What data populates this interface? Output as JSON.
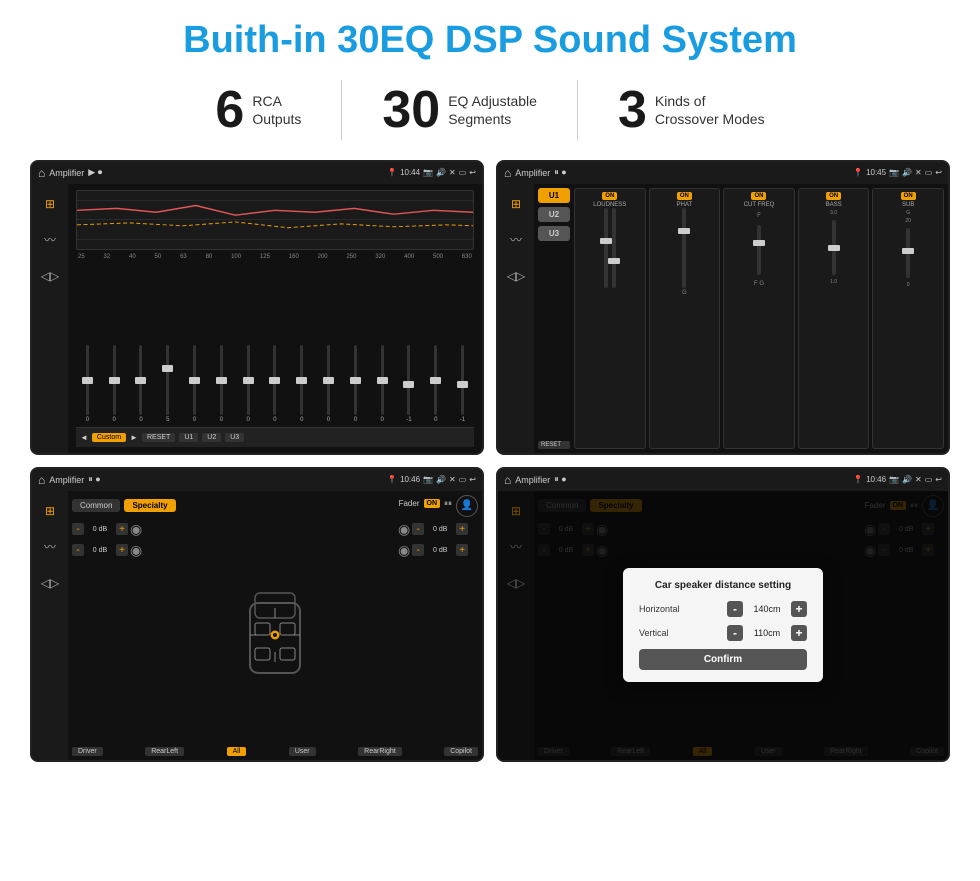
{
  "title": "Buith-in 30EQ DSP Sound System",
  "stats": [
    {
      "number": "6",
      "label": "RCA\nOutputs"
    },
    {
      "number": "30",
      "label": "EQ Adjustable\nSegments"
    },
    {
      "number": "3",
      "label": "Kinds of\nCrossover Modes"
    }
  ],
  "screen1": {
    "app": "Amplifier",
    "time": "10:44",
    "freqs": [
      "25",
      "32",
      "40",
      "50",
      "63",
      "80",
      "100",
      "125",
      "160",
      "200",
      "250",
      "320",
      "400",
      "500",
      "630"
    ],
    "values": [
      "0",
      "0",
      "0",
      "5",
      "0",
      "0",
      "0",
      "0",
      "0",
      "0",
      "0",
      "0",
      "-1",
      "0",
      "-1"
    ],
    "preset": "Custom",
    "buttons": [
      "RESET",
      "U1",
      "U2",
      "U3"
    ]
  },
  "screen2": {
    "app": "Amplifier",
    "time": "10:45",
    "presets": [
      "U1",
      "U2",
      "U3"
    ],
    "channels": [
      {
        "on": true,
        "label": "LOUDNESS"
      },
      {
        "on": true,
        "label": "PHAT"
      },
      {
        "on": true,
        "label": "CUT FREQ"
      },
      {
        "on": true,
        "label": "BASS"
      },
      {
        "on": true,
        "label": "SUB"
      }
    ],
    "reset": "RESET"
  },
  "screen3": {
    "app": "Amplifier",
    "time": "10:46",
    "tabs": [
      "Common",
      "Specialty"
    ],
    "activeTab": "Specialty",
    "fader": "Fader",
    "faderOn": "ON",
    "db_controls": [
      {
        "value": "0 dB"
      },
      {
        "value": "0 dB"
      },
      {
        "value": "0 dB"
      },
      {
        "value": "0 dB"
      }
    ],
    "bottom_labels": [
      "Driver",
      "RearLeft",
      "All",
      "User",
      "RearRight",
      "Copilot"
    ]
  },
  "screen4": {
    "app": "Amplifier",
    "time": "10:46",
    "tabs": [
      "Common",
      "Specialty"
    ],
    "dialog": {
      "title": "Car speaker distance setting",
      "horizontal_label": "Horizontal",
      "horizontal_value": "140cm",
      "vertical_label": "Vertical",
      "vertical_value": "110cm",
      "confirm_label": "Confirm"
    },
    "db_controls": [
      {
        "value": "0 dB"
      },
      {
        "value": "0 dB"
      }
    ],
    "bottom_labels": [
      "Driver",
      "RearLeft",
      "User",
      "RearRight",
      "Copilot"
    ]
  }
}
